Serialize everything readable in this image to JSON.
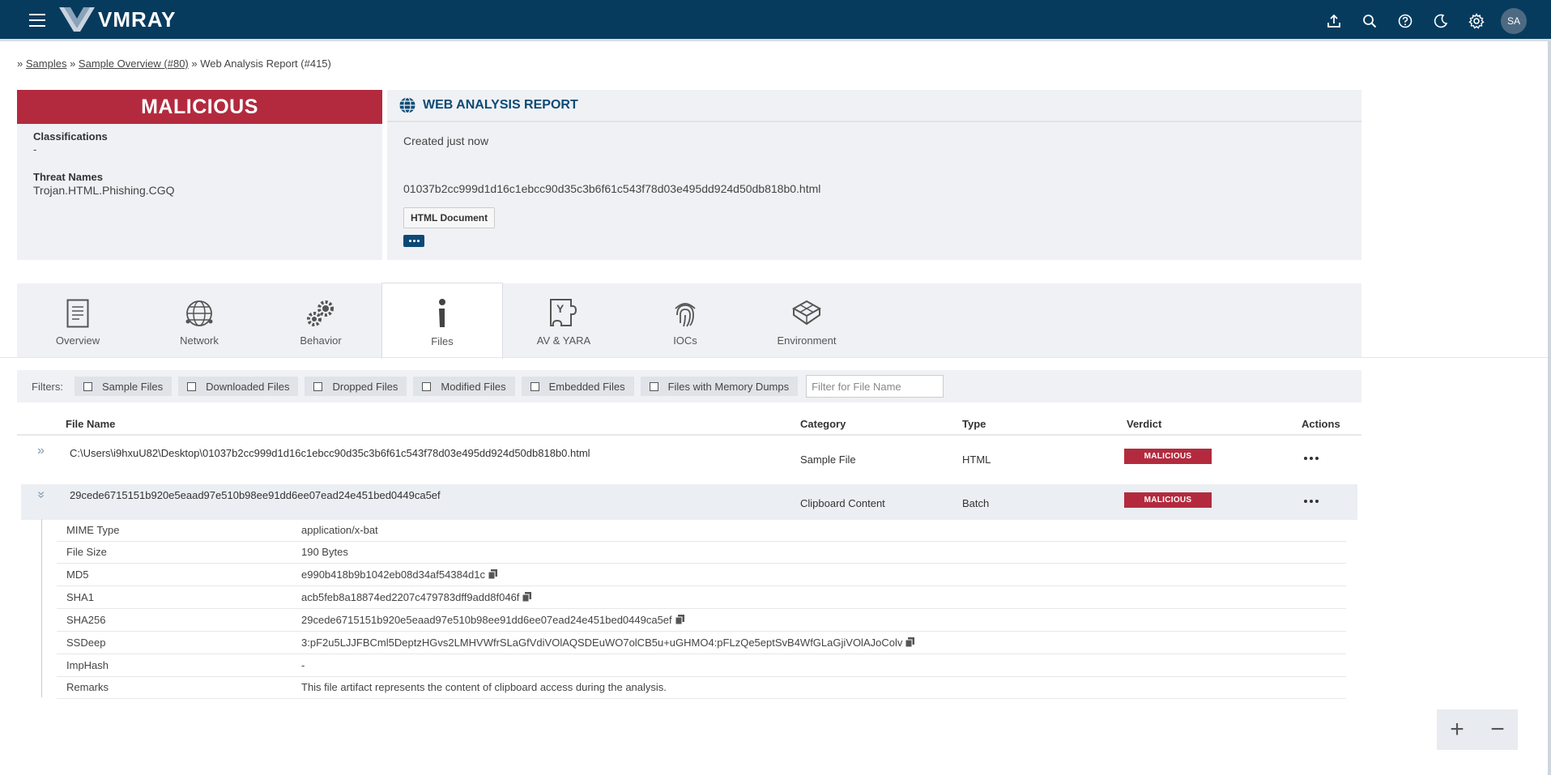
{
  "header": {
    "logo_text": "VMRAY",
    "user_initials": "SA",
    "icons": [
      "upload-icon",
      "search-icon",
      "help-icon",
      "dark-mode-icon",
      "settings-icon"
    ]
  },
  "breadcrumb": {
    "prefix": "»",
    "samples": "Samples",
    "sep1": "»",
    "sample_overview": "Sample Overview (#80)",
    "sep2": "»",
    "current": "Web Analysis Report (#415)"
  },
  "verdict": {
    "label": "MALICIOUS",
    "color": "#b32a3e",
    "classifications_label": "Classifications",
    "classifications_value": "-",
    "threat_names_label": "Threat Names",
    "threat_names_value": "Trojan.HTML.Phishing.CGQ"
  },
  "report": {
    "title": "WEB ANALYSIS REPORT",
    "created": "Created just now",
    "file_name": "01037b2cc999d1d16c1ebcc90d35c3b6f61c543f78d03e495dd924d50db818b0.html",
    "tag": "HTML Document"
  },
  "tabs": [
    {
      "label": "Overview",
      "icon": "document-icon"
    },
    {
      "label": "Network",
      "icon": "globe-icon"
    },
    {
      "label": "Behavior",
      "icon": "gears-icon"
    },
    {
      "label": "Files",
      "icon": "info-icon",
      "active": true
    },
    {
      "label": "AV & YARA",
      "icon": "puzzle-icon"
    },
    {
      "label": "IOCs",
      "icon": "fingerprint-icon"
    },
    {
      "label": "Environment",
      "icon": "cube-icon"
    }
  ],
  "filters": {
    "label": "Filters:",
    "options": [
      "Sample Files",
      "Downloaded Files",
      "Dropped Files",
      "Modified Files",
      "Embedded Files",
      "Files with Memory Dumps"
    ],
    "placeholder": "Filter for File Name"
  },
  "table": {
    "columns": [
      "File Name",
      "Category",
      "Type",
      "Verdict",
      "Actions"
    ],
    "rows": [
      {
        "file_name": "C:\\Users\\i9hxuU82\\Desktop\\01037b2cc999d1d16c1ebcc90d35c3b6f61c543f78d03e495dd924d50db818b0.html",
        "category": "Sample File",
        "type": "HTML",
        "verdict": "MALICIOUS"
      },
      {
        "file_name": "29cede6715151b920e5eaad97e510b98ee91dd6ee07ead24e451bed0449ca5ef",
        "category": "Clipboard Content",
        "type": "Batch",
        "verdict": "MALICIOUS"
      }
    ]
  },
  "details": [
    {
      "label": "MIME Type",
      "value": "application/x-bat"
    },
    {
      "label": "File Size",
      "value": "190 Bytes"
    },
    {
      "label": "MD5",
      "value": "e990b418b9b1042eb08d34af54384d1c",
      "copy": true
    },
    {
      "label": "SHA1",
      "value": "acb5feb8a18874ed2207c479783dff9add8f046f",
      "copy": true
    },
    {
      "label": "SHA256",
      "value": "29cede6715151b920e5eaad97e510b98ee91dd6ee07ead24e451bed0449ca5ef",
      "copy": true
    },
    {
      "label": "SSDeep",
      "value": "3:pF2u5LJJFBCml5DeptzHGvs2LMHVWfrSLaGfVdiVOlAQSDEuWO7olCB5u+uGHMO4:pFLzQe5eptSvB4WfGLaGjiVOlAJoColv",
      "copy": true
    },
    {
      "label": "ImpHash",
      "value": "-"
    },
    {
      "label": "Remarks",
      "value": "This file artifact represents the content of clipboard access during the analysis."
    }
  ],
  "zoom": {
    "plus": "+",
    "minus": "−"
  }
}
